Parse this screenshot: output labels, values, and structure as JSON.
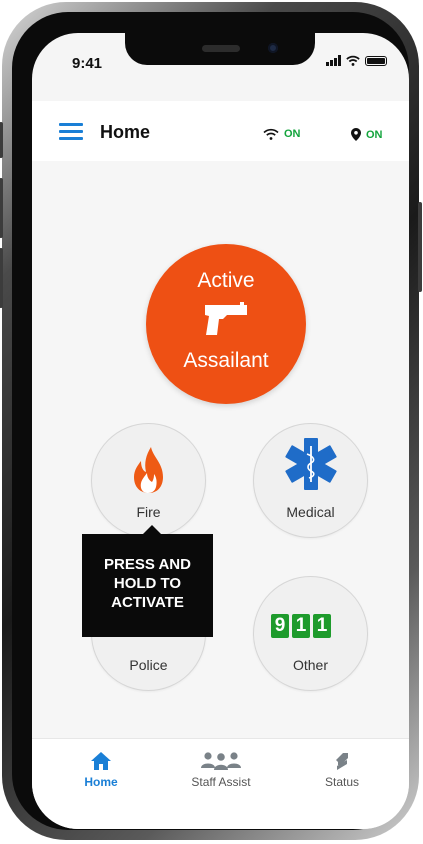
{
  "status_bar": {
    "time": "9:41"
  },
  "header": {
    "title": "Home",
    "wifi_status": "ON",
    "location_status": "ON"
  },
  "emergency_buttons": {
    "active_assailant": {
      "line1": "Active",
      "line2": "Assailant",
      "icon": "gun-icon"
    },
    "fire": {
      "label": "Fire",
      "icon": "flame-icon"
    },
    "medical": {
      "label": "Medical",
      "icon": "star-of-life-icon"
    },
    "police": {
      "label": "Police",
      "icon": "police-icon"
    },
    "other": {
      "label": "Other",
      "icon": "911-icon",
      "digits": [
        "9",
        "1",
        "1"
      ]
    }
  },
  "tooltip": {
    "lines": [
      "PRESS AND",
      "HOLD TO",
      "ACTIVATE"
    ]
  },
  "tabs": [
    {
      "label": "Home",
      "icon": "home-icon",
      "active": true
    },
    {
      "label": "Staff Assist",
      "icon": "staff-group-icon",
      "active": false
    },
    {
      "label": "Status",
      "icon": "status-icon",
      "active": false
    }
  ],
  "colors": {
    "accent": "#1a7fd6",
    "alert": "#ee5014",
    "on_status": "#13a43c",
    "medical_blue": "#1f6cc8",
    "badge_green": "#1e9b2c"
  }
}
